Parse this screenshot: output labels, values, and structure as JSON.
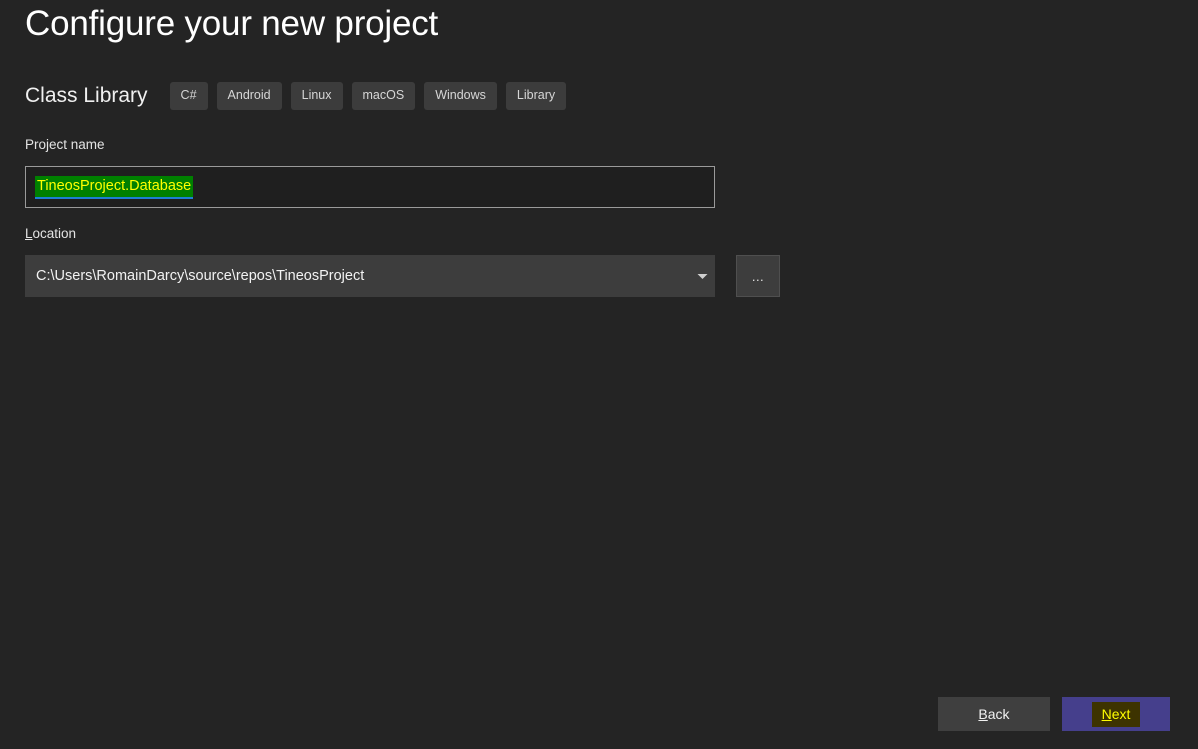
{
  "page": {
    "title": "Configure your new project",
    "background_color": "#242424"
  },
  "template": {
    "name": "Class Library",
    "tags": [
      {
        "label": "C#"
      },
      {
        "label": "Android"
      },
      {
        "label": "Linux"
      },
      {
        "label": "macOS"
      },
      {
        "label": "Windows"
      },
      {
        "label": "Library"
      }
    ]
  },
  "fields": {
    "project_name": {
      "label": "Project name",
      "value": "TineosProject.Database",
      "highlight_background_color": "#008000",
      "highlight_text_color": "#ffff00",
      "underline_color": "#1d7fd4"
    },
    "location": {
      "label_prefix": "L",
      "label_rest": "ocation",
      "value": "C:\\Users\\RomainDarcy\\source\\repos\\TineosProject",
      "dropdown_icon": "chevron-down-icon",
      "browse_button_label": "...",
      "browse_button_icon": "ellipsis-icon"
    }
  },
  "footer": {
    "back": {
      "accesskey": "B",
      "label_rest": "ack",
      "background_color": "#3f3f3f"
    },
    "next": {
      "accesskey": "N",
      "label_rest": "ext",
      "background_color": "#453f8c",
      "focus_highlight_color": "#3d3300",
      "focus_text_color": "#ffff00"
    }
  }
}
